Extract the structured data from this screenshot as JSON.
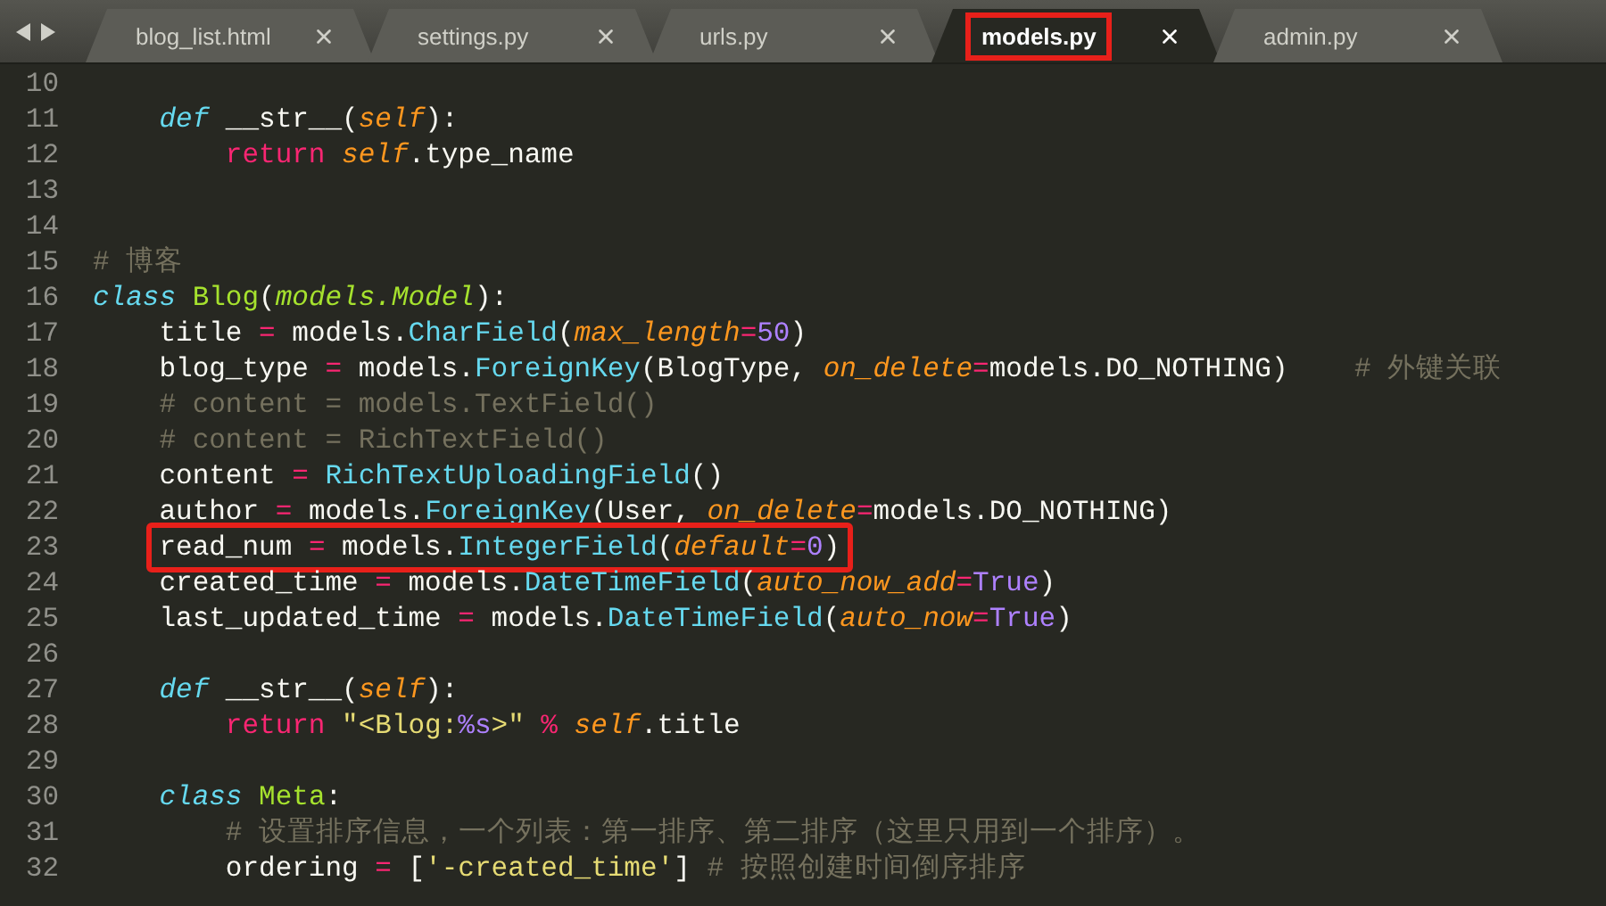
{
  "tabs": [
    {
      "label": "blog_list.html",
      "selected": false,
      "highlighted": false
    },
    {
      "label": "settings.py",
      "selected": false,
      "highlighted": false
    },
    {
      "label": "urls.py",
      "selected": false,
      "highlighted": false
    },
    {
      "label": "models.py",
      "selected": true,
      "highlighted": true
    },
    {
      "label": "admin.py",
      "selected": false,
      "highlighted": false
    }
  ],
  "lines": [
    {
      "number": "10"
    },
    {
      "number": "11",
      "highlighted": false,
      "tokens": [
        {
          "kind": "storage",
          "text": "    def"
        },
        {
          "kind": "plain",
          "text": " __str__("
        },
        {
          "kind": "param",
          "text": "self"
        },
        {
          "kind": "plain",
          "text": "):"
        }
      ]
    },
    {
      "number": "12",
      "highlighted": false,
      "tokens": [
        {
          "kind": "keyword",
          "text": "        return "
        },
        {
          "kind": "self",
          "text": "self"
        },
        {
          "kind": "plain",
          "text": ".type_name"
        }
      ]
    },
    {
      "number": "13"
    },
    {
      "number": "14"
    },
    {
      "number": "15",
      "highlighted": false,
      "tokens": [
        {
          "kind": "comment",
          "text": "# 博客"
        }
      ]
    },
    {
      "number": "16",
      "highlighted": false,
      "tokens": [
        {
          "kind": "storage",
          "text": "class"
        },
        {
          "kind": "class",
          "text": " Blog"
        },
        {
          "kind": "plain",
          "text": "("
        },
        {
          "kind": "inherit",
          "text": "models.Model"
        },
        {
          "kind": "plain",
          "text": "):"
        }
      ]
    },
    {
      "number": "17",
      "highlighted": false,
      "tokens": [
        {
          "kind": "plain",
          "text": "    title "
        },
        {
          "kind": "keyword",
          "text": "="
        },
        {
          "kind": "plain",
          "text": " models."
        },
        {
          "kind": "call",
          "text": "CharField"
        },
        {
          "kind": "plain",
          "text": "("
        },
        {
          "kind": "param",
          "text": "max_length"
        },
        {
          "kind": "keyword",
          "text": "="
        },
        {
          "kind": "number",
          "text": "50"
        },
        {
          "kind": "plain",
          "text": ")"
        }
      ]
    },
    {
      "number": "18",
      "highlighted": false,
      "tokens": [
        {
          "kind": "plain",
          "text": "    blog_type "
        },
        {
          "kind": "keyword",
          "text": "="
        },
        {
          "kind": "plain",
          "text": " models."
        },
        {
          "kind": "call",
          "text": "ForeignKey"
        },
        {
          "kind": "plain",
          "text": "(BlogType, "
        },
        {
          "kind": "param",
          "text": "on_delete"
        },
        {
          "kind": "keyword",
          "text": "="
        },
        {
          "kind": "plain",
          "text": "models.DO_NOTHING)"
        },
        {
          "kind": "comment",
          "text": "    # 外键关联"
        }
      ]
    },
    {
      "number": "19",
      "highlighted": false,
      "tokens": [
        {
          "kind": "comment",
          "text": "    # content = models.TextField()"
        }
      ]
    },
    {
      "number": "20",
      "highlighted": false,
      "tokens": [
        {
          "kind": "comment",
          "text": "    # content = RichTextField()"
        }
      ]
    },
    {
      "number": "21",
      "highlighted": false,
      "tokens": [
        {
          "kind": "plain",
          "text": "    content "
        },
        {
          "kind": "keyword",
          "text": "="
        },
        {
          "kind": "call",
          "text": " RichTextUploadingField"
        },
        {
          "kind": "plain",
          "text": "()"
        }
      ]
    },
    {
      "number": "22",
      "highlighted": false,
      "tokens": [
        {
          "kind": "plain",
          "text": "    author "
        },
        {
          "kind": "keyword",
          "text": "="
        },
        {
          "kind": "plain",
          "text": " models."
        },
        {
          "kind": "call",
          "text": "ForeignKey"
        },
        {
          "kind": "plain",
          "text": "(User, "
        },
        {
          "kind": "param",
          "text": "on_delete"
        },
        {
          "kind": "keyword",
          "text": "="
        },
        {
          "kind": "plain",
          "text": "models.DO_NOTHING)"
        }
      ]
    },
    {
      "number": "23",
      "highlighted": true,
      "tokens": [
        {
          "kind": "plain",
          "text": "    read_num "
        },
        {
          "kind": "keyword",
          "text": "="
        },
        {
          "kind": "plain",
          "text": " models."
        },
        {
          "kind": "call",
          "text": "IntegerField"
        },
        {
          "kind": "plain",
          "text": "("
        },
        {
          "kind": "param",
          "text": "default"
        },
        {
          "kind": "keyword",
          "text": "="
        },
        {
          "kind": "number",
          "text": "0"
        },
        {
          "kind": "plain",
          "text": ")"
        }
      ]
    },
    {
      "number": "24",
      "highlighted": false,
      "tokens": [
        {
          "kind": "plain",
          "text": "    created_time "
        },
        {
          "kind": "keyword",
          "text": "="
        },
        {
          "kind": "plain",
          "text": " models."
        },
        {
          "kind": "call",
          "text": "DateTimeField"
        },
        {
          "kind": "plain",
          "text": "("
        },
        {
          "kind": "param",
          "text": "auto_now_add"
        },
        {
          "kind": "keyword",
          "text": "="
        },
        {
          "kind": "number",
          "text": "True"
        },
        {
          "kind": "plain",
          "text": ")"
        }
      ]
    },
    {
      "number": "25",
      "highlighted": false,
      "tokens": [
        {
          "kind": "plain",
          "text": "    last_updated_time "
        },
        {
          "kind": "keyword",
          "text": "="
        },
        {
          "kind": "plain",
          "text": " models."
        },
        {
          "kind": "call",
          "text": "DateTimeField"
        },
        {
          "kind": "plain",
          "text": "("
        },
        {
          "kind": "param",
          "text": "auto_now"
        },
        {
          "kind": "keyword",
          "text": "="
        },
        {
          "kind": "number",
          "text": "True"
        },
        {
          "kind": "plain",
          "text": ")"
        }
      ]
    },
    {
      "number": "26"
    },
    {
      "number": "27",
      "highlighted": false,
      "tokens": [
        {
          "kind": "storage",
          "text": "    def"
        },
        {
          "kind": "plain",
          "text": " __str__("
        },
        {
          "kind": "param",
          "text": "self"
        },
        {
          "kind": "plain",
          "text": "):"
        }
      ]
    },
    {
      "number": "28",
      "highlighted": false,
      "tokens": [
        {
          "kind": "keyword",
          "text": "        return"
        },
        {
          "kind": "string",
          "text": " \"<Blog:"
        },
        {
          "kind": "number",
          "text": "%s"
        },
        {
          "kind": "string",
          "text": ">\""
        },
        {
          "kind": "keyword",
          "text": " % "
        },
        {
          "kind": "self",
          "text": "self"
        },
        {
          "kind": "plain",
          "text": ".title"
        }
      ]
    },
    {
      "number": "29"
    },
    {
      "number": "30",
      "highlighted": false,
      "tokens": [
        {
          "kind": "storage",
          "text": "    class"
        },
        {
          "kind": "class",
          "text": " Meta"
        },
        {
          "kind": "plain",
          "text": ":"
        }
      ]
    },
    {
      "number": "31",
      "highlighted": false,
      "tokens": [
        {
          "kind": "comment",
          "text": "        # 设置排序信息，一个列表：第一排序、第二排序（这里只用到一个排序）。"
        }
      ]
    },
    {
      "number": "32",
      "highlighted": false,
      "tokens": [
        {
          "kind": "plain",
          "text": "        ordering "
        },
        {
          "kind": "keyword",
          "text": "="
        },
        {
          "kind": "plain",
          "text": " ["
        },
        {
          "kind": "string",
          "text": "'-created_time'"
        },
        {
          "kind": "plain",
          "text": "]"
        },
        {
          "kind": "comment",
          "text": " # 按照创建时间倒序排序"
        }
      ]
    }
  ]
}
